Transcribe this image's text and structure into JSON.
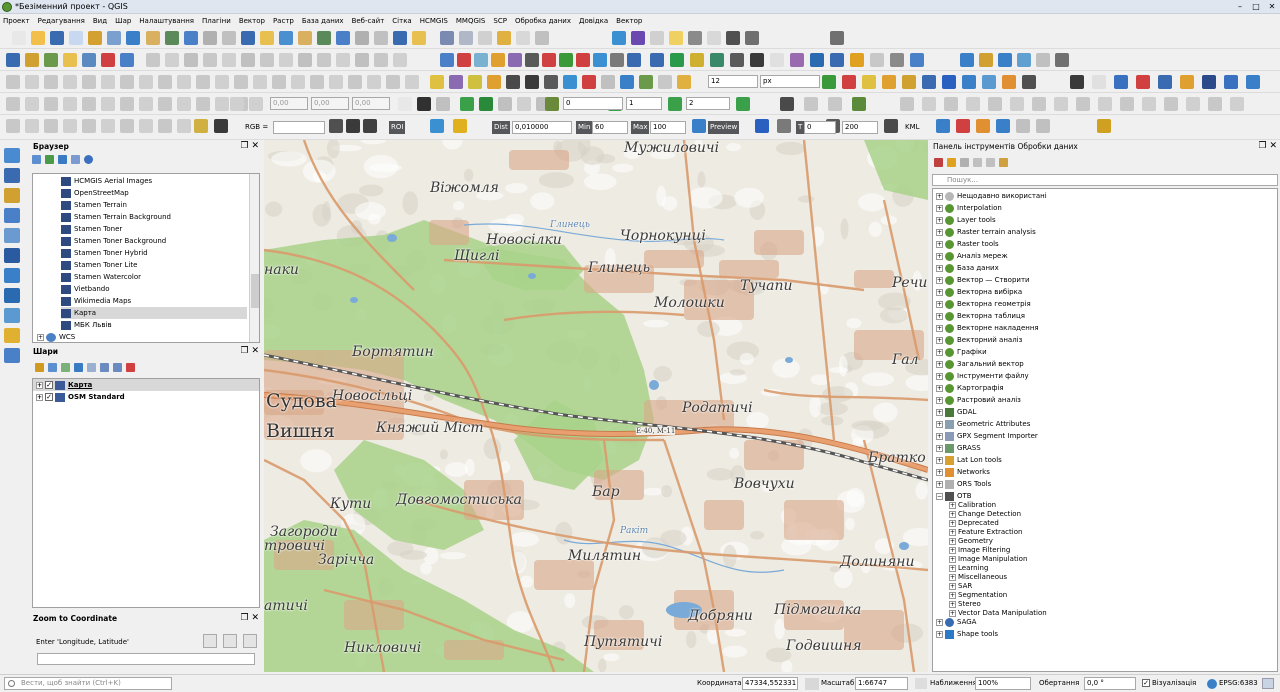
{
  "window": {
    "title": "*Безіменний проект - QGIS"
  },
  "menu": [
    "Проект",
    "Редагування",
    "Вид",
    "Шар",
    "Налаштування",
    "Плагіни",
    "Вектор",
    "Растр",
    "База даних",
    "Веб-сайт",
    "Сітка",
    "HCMGIS",
    "MMQGIS",
    "SCP",
    "Обробка даних",
    "Довідка",
    "Вектор"
  ],
  "toolbar3": {
    "font_size": "12",
    "unit": "px"
  },
  "toolbar4": {
    "x1": "0,00",
    "x2": "0,00",
    "x3": "0,00",
    "n1": "0",
    "n2": "1",
    "n3": "2"
  },
  "toolbar5": {
    "rgb_label": "RGB =",
    "roi_label": "ROI",
    "dist_label": "Dist",
    "dist_value": "0,010000",
    "min_label": "Min",
    "min_value": "60",
    "max_label": "Max",
    "max_value": "100",
    "preview_label": "Preview",
    "t_label": "T",
    "t_value": "0",
    "s_label": "S",
    "s_value": "200",
    "kml_label": "KML"
  },
  "browser": {
    "title": "Браузер",
    "items": [
      "HCMGIS Aerial Images",
      "OpenStreetMap",
      "Stamen Terrain",
      "Stamen Terrain Background",
      "Stamen Toner",
      "Stamen Toner Background",
      "Stamen Toner Hybrid",
      "Stamen Toner Lite",
      "Stamen Watercolor",
      "Vietbando",
      "Wikimedia Maps",
      "Карта",
      "МБК Львів"
    ],
    "wcs_label": "WCS"
  },
  "layers": {
    "title": "Шари",
    "items": [
      "Карта",
      "OSM Standard"
    ]
  },
  "zoom": {
    "title": "Zoom to Coordinate",
    "prompt": "Enter 'Longitude, Latitude'",
    "input": ""
  },
  "map": {
    "labels": [
      "Мужиловичі",
      "Віжомля",
      "Новосілки",
      "Щиглі",
      "Чорнокунці",
      "Глинець",
      "Молошки",
      "Тучапи",
      "Речи",
      "наки",
      "Бортятин",
      "Гал",
      "Новосільці",
      "Родатичі",
      "Судова",
      "Вишня",
      "Княжий Міст",
      "Братко",
      "Кути",
      "Довгомостиська",
      "Бар",
      "Вовчухи",
      "Загороди",
      "тровичі",
      "Зарічча",
      "Милятин",
      "Долиняни",
      "атичі",
      "Добряни",
      "Підмогилка",
      "Никловичі",
      "Путятичі",
      "Годвишня"
    ],
    "water_labels": [
      "Глинець",
      "Ракіт"
    ],
    "road_label": "Е-40, М-11"
  },
  "processing": {
    "title": "Панель інструментів Обробки даних",
    "search_placeholder": "Пошук...",
    "top_items": [
      "Нещодавно використані",
      "Interpolation",
      "Layer tools",
      "Raster terrain analysis",
      "Raster tools",
      "Аналіз мереж",
      "База даних",
      "Вектор — Створити",
      "Векторна вибірка",
      "Векторна геометрія",
      "Векторна таблиця",
      "Векторне накладення",
      "Векторний аналіз",
      "Графіки",
      "Загальний вектор",
      "Інструменти файлу",
      "Картографія",
      "Растровий аналіз",
      "GDAL",
      "Geometric Attributes",
      "GPX Segment Importer",
      "GRASS",
      "Lat Lon tools",
      "Networks",
      "ORS Tools",
      "OTB"
    ],
    "otb_children": [
      "Calibration",
      "Change Detection",
      "Deprecated",
      "Feature Extraction",
      "Geometry",
      "Image Filtering",
      "Image Manipulation",
      "Learning",
      "Miscellaneous",
      "SAR",
      "Segmentation",
      "Stereo",
      "Vector Data Manipulation"
    ],
    "bottom_items": [
      "SAGA",
      "Shape tools"
    ]
  },
  "status": {
    "search_placeholder": "Вести, щоб знайти (Ctrl+K)",
    "coord_label": "Координата",
    "coord_value": "47334,5523311",
    "scale_label": "Масштаб",
    "scale_value": "1:66747",
    "magnifier_label": "Наближення",
    "magnifier_value": "100%",
    "rotation_label": "Обертання",
    "rotation_value": "0,0 °",
    "render_label": "Візуалізація",
    "crs": "EPSG:6383"
  },
  "colors": {
    "accent": "#2f6cc4",
    "road": "#d99a6c",
    "forest": "#a8d28a",
    "water": "#7aaad8",
    "urban": "#d8a688"
  }
}
